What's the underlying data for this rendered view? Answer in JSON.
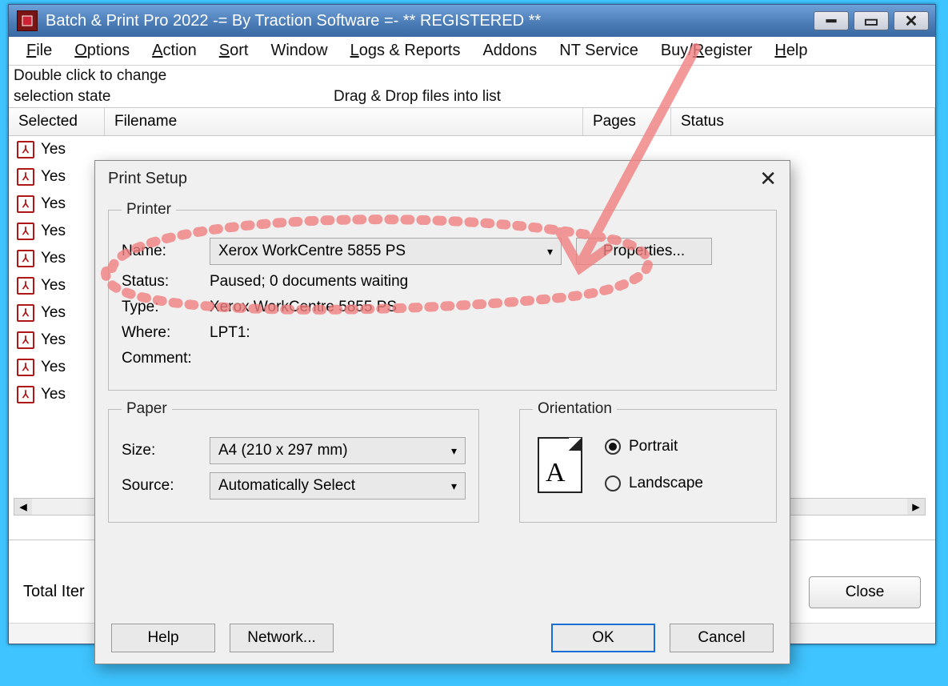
{
  "window": {
    "title": "Batch & Print Pro 2022 -= By Traction Software =- ** REGISTERED **"
  },
  "menu": {
    "items": [
      "File",
      "Options",
      "Action",
      "Sort",
      "Window",
      "Logs & Reports",
      "Addons",
      "NT Service",
      "Buy/Register",
      "Help"
    ]
  },
  "hints": {
    "line1": "Double click to change",
    "line2": "selection state",
    "drag": "Drag & Drop files into list"
  },
  "columns": {
    "selected": "Selected",
    "filename": "Filename",
    "pages": "Pages",
    "status": "Status"
  },
  "rows": [
    {
      "selected": "Yes"
    },
    {
      "selected": "Yes"
    },
    {
      "selected": "Yes"
    },
    {
      "selected": "Yes"
    },
    {
      "selected": "Yes"
    },
    {
      "selected": "Yes"
    },
    {
      "selected": "Yes"
    },
    {
      "selected": "Yes"
    },
    {
      "selected": "Yes"
    },
    {
      "selected": "Yes"
    }
  ],
  "footer": {
    "total_label": "Total Iter",
    "close": "Close"
  },
  "dialog": {
    "title": "Print Setup",
    "printer": {
      "legend": "Printer",
      "name_label": "Name:",
      "name_value": "Xerox WorkCentre 5855 PS",
      "properties": "Properties...",
      "status_label": "Status:",
      "status_value": "Paused; 0 documents waiting",
      "type_label": "Type:",
      "type_value": "Xerox WorkCentre 5855 PS",
      "where_label": "Where:",
      "where_value": "LPT1:",
      "comment_label": "Comment:",
      "comment_value": ""
    },
    "paper": {
      "legend": "Paper",
      "size_label": "Size:",
      "size_value": "A4 (210 x 297 mm)",
      "source_label": "Source:",
      "source_value": "Automatically Select"
    },
    "orientation": {
      "legend": "Orientation",
      "portrait": "Portrait",
      "landscape": "Landscape",
      "selected": "portrait"
    },
    "buttons": {
      "help": "Help",
      "network": "Network...",
      "ok": "OK",
      "cancel": "Cancel"
    }
  },
  "annotation_color": "#f08888"
}
